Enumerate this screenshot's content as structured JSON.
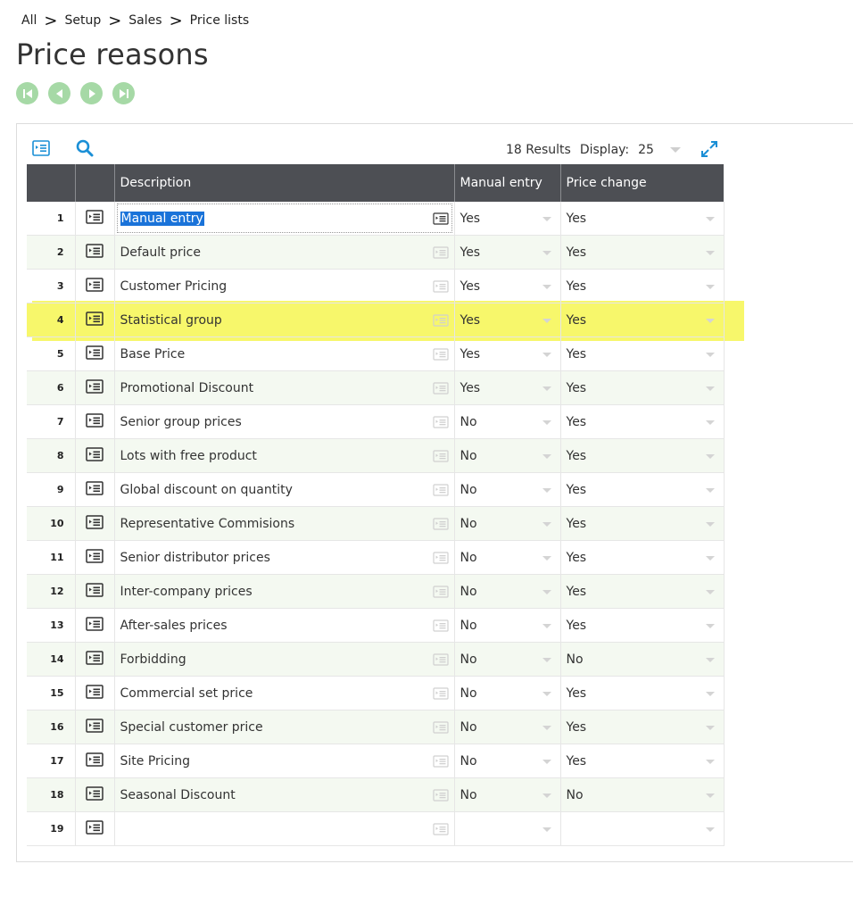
{
  "breadcrumb": [
    "All",
    "Setup",
    "Sales",
    "Price lists"
  ],
  "breadcrumb_separator": ">",
  "page_title": "Price reasons",
  "nav": {
    "first": "first-icon",
    "prev": "previous-icon",
    "next": "next-icon",
    "last": "last-icon",
    "color": "#a6d9a6"
  },
  "toolbar": {
    "results_label": "18 Results",
    "display_label": "Display:",
    "display_value": "25",
    "accent_color": "#1a8fd6"
  },
  "table": {
    "columns": [
      "",
      "",
      "Description",
      "Manual entry",
      "Price change"
    ],
    "rows": [
      {
        "num": "1",
        "description": "Manual entry",
        "manual_entry": "Yes",
        "price_change": "Yes"
      },
      {
        "num": "2",
        "description": "Default price",
        "manual_entry": "Yes",
        "price_change": "Yes"
      },
      {
        "num": "3",
        "description": "Customer Pricing",
        "manual_entry": "Yes",
        "price_change": "Yes"
      },
      {
        "num": "4",
        "description": "Statistical group",
        "manual_entry": "Yes",
        "price_change": "Yes"
      },
      {
        "num": "5",
        "description": "Base Price",
        "manual_entry": "Yes",
        "price_change": "Yes"
      },
      {
        "num": "6",
        "description": "Promotional Discount",
        "manual_entry": "Yes",
        "price_change": "Yes"
      },
      {
        "num": "7",
        "description": "Senior group prices",
        "manual_entry": "No",
        "price_change": "Yes"
      },
      {
        "num": "8",
        "description": "Lots with free product",
        "manual_entry": "No",
        "price_change": "Yes"
      },
      {
        "num": "9",
        "description": "Global discount on quantity",
        "manual_entry": "No",
        "price_change": "Yes"
      },
      {
        "num": "10",
        "description": "Representative Commisions",
        "manual_entry": "No",
        "price_change": "Yes"
      },
      {
        "num": "11",
        "description": "Senior distributor prices",
        "manual_entry": "No",
        "price_change": "Yes"
      },
      {
        "num": "12",
        "description": "Inter-company prices",
        "manual_entry": "No",
        "price_change": "Yes"
      },
      {
        "num": "13",
        "description": "After-sales prices",
        "manual_entry": "No",
        "price_change": "Yes"
      },
      {
        "num": "14",
        "description": "Forbidding",
        "manual_entry": "No",
        "price_change": "No"
      },
      {
        "num": "15",
        "description": "Commercial set price",
        "manual_entry": "No",
        "price_change": "Yes"
      },
      {
        "num": "16",
        "description": "Special customer price",
        "manual_entry": "No",
        "price_change": "Yes"
      },
      {
        "num": "17",
        "description": "Site Pricing",
        "manual_entry": "No",
        "price_change": "Yes"
      },
      {
        "num": "18",
        "description": "Seasonal Discount",
        "manual_entry": "No",
        "price_change": "No"
      },
      {
        "num": "19",
        "description": "",
        "manual_entry": "",
        "price_change": ""
      }
    ],
    "selected_row": "1",
    "highlighted_row": "4",
    "header_color": "#4d4f54",
    "highlight_color": "#f7f76b",
    "alt_row_color": "#f4f9f1",
    "selection_color": "#1a73d9"
  }
}
